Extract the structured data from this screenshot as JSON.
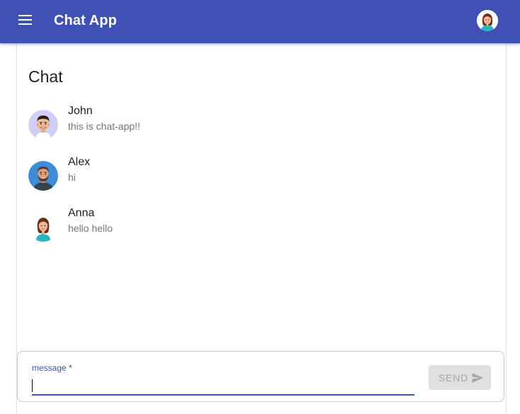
{
  "appbar": {
    "title": "Chat App",
    "color": "#3f51b5",
    "menu_icon": "menu-icon",
    "account_icon": "account-avatar"
  },
  "chat": {
    "heading": "Chat",
    "items": [
      {
        "name": "John",
        "message": "this is chat-app!!",
        "avatar": "john-avatar"
      },
      {
        "name": "Alex",
        "message": "hi",
        "avatar": "alex-avatar"
      },
      {
        "name": "Anna",
        "message": "hello hello",
        "avatar": "anna-avatar"
      }
    ]
  },
  "composer": {
    "label": "message *",
    "value": "",
    "send_label": "SEND",
    "send_icon": "send-icon",
    "send_disabled": true
  }
}
